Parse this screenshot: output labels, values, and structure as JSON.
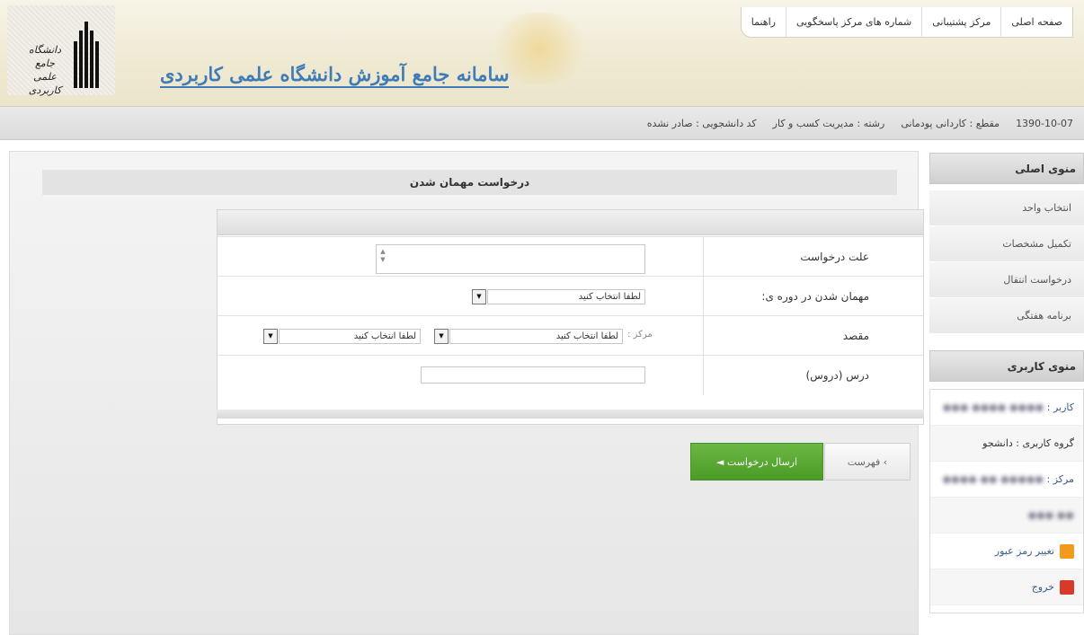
{
  "header": {
    "site_title": "سامانه جامع آموزش دانشگاه علمی کاربردی",
    "logo_text_line1": "دانشگاه جامع",
    "logo_text_line2": "علمی کاربردی",
    "nav": [
      {
        "label": "صفحه اصلی"
      },
      {
        "label": "مرکز پشتیبانی"
      },
      {
        "label": "شماره های مرکز پاسخگویی"
      },
      {
        "label": "راهنما"
      }
    ]
  },
  "infobar": {
    "student_code": "کد دانشجویی : صادر نشده",
    "major": "رشته : مدیریت کسب و کار",
    "grade": "مقطع : کاردانی پودمانی",
    "date": "1390-10-07"
  },
  "main": {
    "page_title": "درخواست مهمان شدن",
    "form": {
      "reason_label": "علت درخواست",
      "term_label": "مهمان شدن در دوره ی:",
      "term_value": "لطفا انتخاب کنید",
      "destination_label": "مقصد",
      "center_prefix": "مرکز :",
      "center_value": "لطفا انتخاب کنید",
      "second_select_value": "لطفا انتخاب کنید",
      "courses_label": "درس (دروس)"
    },
    "btn_list": "› فهرست",
    "btn_send": "ارسال درخواست ◄"
  },
  "sidebar": {
    "main_menu_title": "منوی اصلی",
    "main_menu": [
      {
        "label": "انتخاب واحد"
      },
      {
        "label": "تکمیل مشخصات"
      },
      {
        "label": "درخواست انتقال"
      },
      {
        "label": "برنامه هفتگی"
      }
    ],
    "user_menu_title": "منوی کاربری",
    "user_label": "کاربر :",
    "group_label": "گروه کاربری : دانشجو",
    "center_label": "مرکز :",
    "change_password": "تغییر رمز عبور",
    "logout": "خروج"
  },
  "colors": {
    "title_blue": "#3f7bb6",
    "send_green": "#56a631",
    "header_bg": "#efe9d2"
  }
}
